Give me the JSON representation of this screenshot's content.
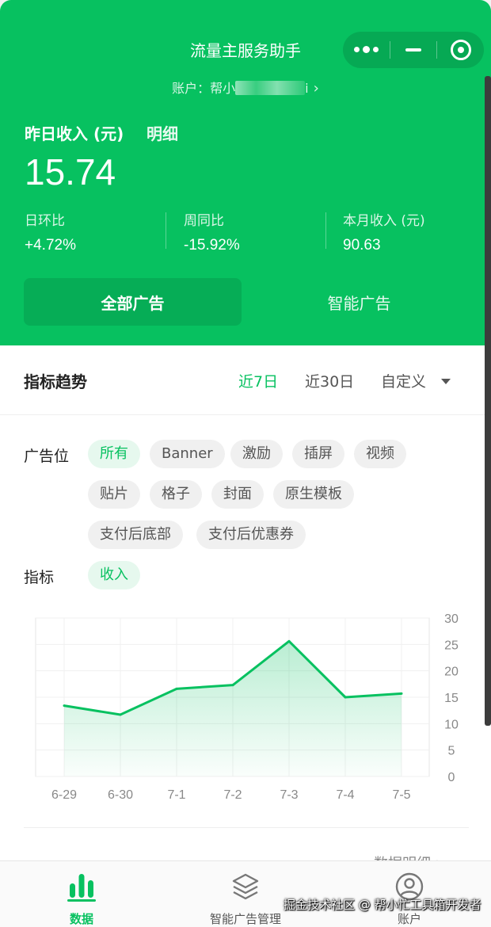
{
  "header": {
    "title": "流量主服务助手",
    "account_prefix": "账户：帮小",
    "account_suffix": "i"
  },
  "capsule": {
    "more_icon": "dots-icon",
    "minimize_icon": "minus-icon",
    "close_icon": "target-icon"
  },
  "income": {
    "label": "昨日收入 (元)",
    "detail_link": "明细",
    "value": "15.74",
    "stats": [
      {
        "label": "日环比",
        "value": "+4.72%"
      },
      {
        "label": "周同比",
        "value": "-15.92%"
      },
      {
        "label": "本月收入 (元)",
        "value": "90.63"
      }
    ]
  },
  "ad_segments": {
    "active": "全部广告",
    "inactive": "智能广告"
  },
  "trend": {
    "title": "指标趋势",
    "ranges": [
      "近7日",
      "近30日",
      "自定义"
    ],
    "selected_range": "近7日",
    "slot_label": "广告位",
    "slots": [
      "所有",
      "Banner",
      "激励",
      "插屏",
      "视频",
      "贴片",
      "格子",
      "封面",
      "原生模板",
      "支付后底部",
      "支付后优惠券"
    ],
    "selected_slot": "所有",
    "metric_label": "指标",
    "metrics": [
      "收入"
    ],
    "selected_metric": "收入",
    "more_link": "数据明细 >"
  },
  "chart_data": {
    "type": "area",
    "categories": [
      "6-29",
      "6-30",
      "7-1",
      "7-2",
      "7-3",
      "7-4",
      "7-5"
    ],
    "series": [
      {
        "values": [
          13.4,
          11.7,
          16.6,
          17.3,
          25.6,
          15.0,
          15.7
        ]
      }
    ],
    "yticks": [
      0,
      5,
      10,
      15,
      20,
      25,
      30
    ],
    "ylim": [
      0,
      30
    ],
    "y_axis_side": "right",
    "grid": true,
    "color": "#07c160",
    "title": "",
    "xlabel": "",
    "ylabel": ""
  },
  "tabbar": {
    "tabs": [
      {
        "label": "数据",
        "icon": "bar-chart-icon",
        "active": true
      },
      {
        "label": "智能广告管理",
        "icon": "layers-icon",
        "active": false
      },
      {
        "label": "账户",
        "icon": "user-icon",
        "active": false
      }
    ]
  },
  "watermark": "掘金技术社区 @ 帮小忙工具箱开发者",
  "colors": {
    "brand": "#07c160",
    "brand_dark": "#06ad56"
  }
}
